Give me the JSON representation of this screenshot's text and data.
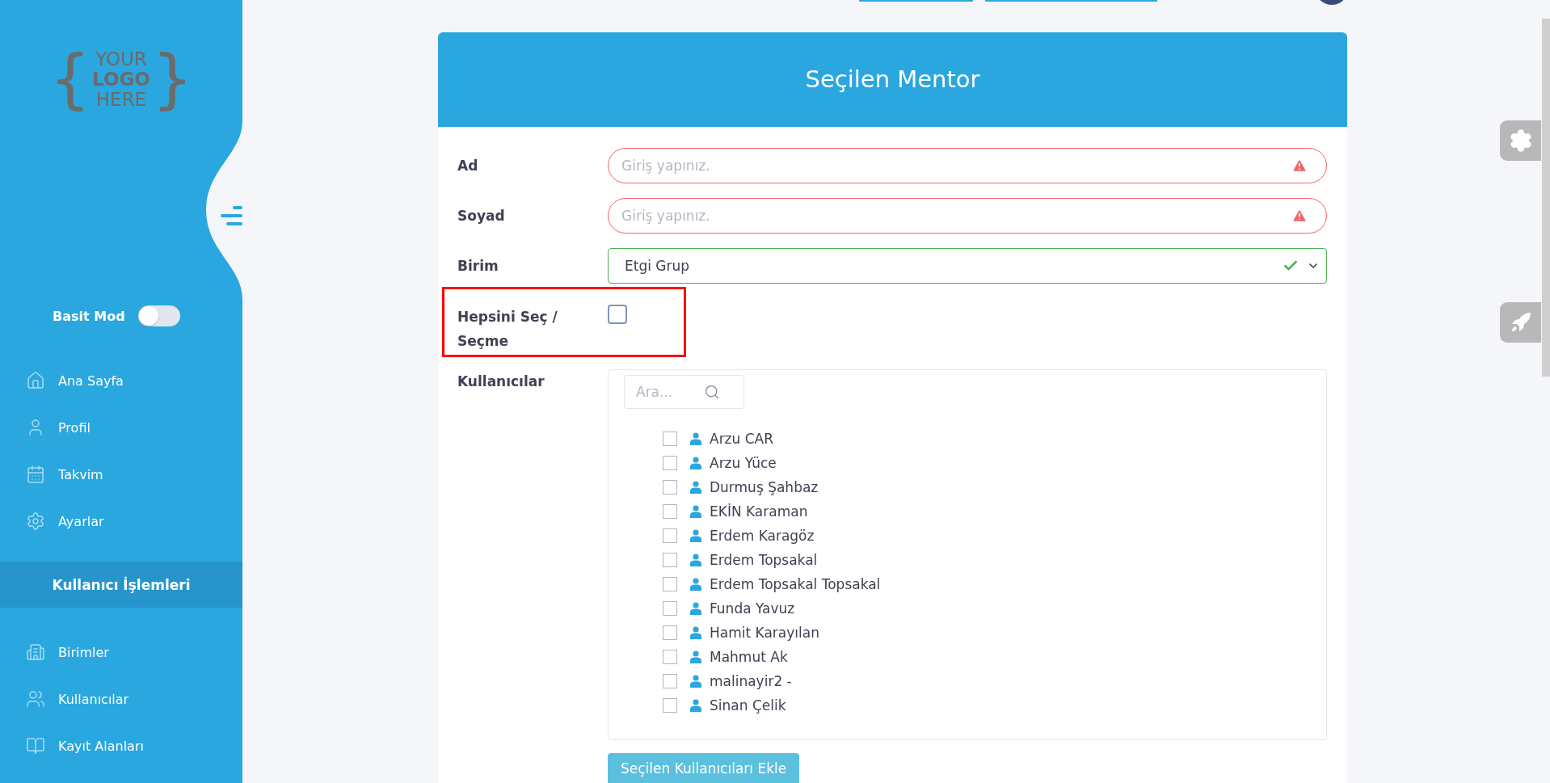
{
  "sidebar": {
    "logo": {
      "left_brace": "{",
      "top": "YOUR",
      "middle": "LOGO",
      "bottom": "HERE",
      "right_brace": "}"
    },
    "simple_mode": {
      "label": "Basit Mod",
      "on": false
    },
    "items": [
      {
        "label": "Ana Sayfa"
      },
      {
        "label": "Profil"
      },
      {
        "label": "Takvim"
      },
      {
        "label": "Ayarlar"
      }
    ],
    "section": {
      "label": "Kullanıcı İşlemleri",
      "selected": true
    },
    "section_items": [
      {
        "label": "Birimler"
      },
      {
        "label": "Kullanıcılar"
      },
      {
        "label": "Kayıt Alanları"
      }
    ]
  },
  "card": {
    "title": "Seçilen Mentor",
    "fields": [
      {
        "label": "Ad",
        "kind": "text",
        "placeholder": "Giriş yapınız.",
        "invalid": true
      },
      {
        "label": "Soyad",
        "kind": "text",
        "placeholder": "Giriş yapınız.",
        "invalid": true
      },
      {
        "label": "Birim",
        "kind": "select",
        "value": "Etgi Grup",
        "valid": true
      }
    ],
    "select_all": {
      "label": "Hepsini Seç / Seçme",
      "checked": false,
      "highlighted": true
    },
    "users": {
      "label": "Kullanıcılar",
      "search_placeholder": "Ara...",
      "items": [
        {
          "name": "Arzu CAR",
          "checked": false
        },
        {
          "name": "Arzu Yüce",
          "checked": false
        },
        {
          "name": "Durmuş Şahbaz",
          "checked": false
        },
        {
          "name": "EKİN Karaman",
          "checked": false
        },
        {
          "name": "Erdem Karagöz",
          "checked": false
        },
        {
          "name": "Erdem Topsakal",
          "checked": false
        },
        {
          "name": "Erdem Topsakal Topsakal",
          "checked": false
        },
        {
          "name": "Funda Yavuz",
          "checked": false
        },
        {
          "name": "Hamit Karayılan",
          "checked": false
        },
        {
          "name": "Mahmut Ak",
          "checked": false
        },
        {
          "name": "malinayir2 -",
          "checked": false
        },
        {
          "name": "Sinan Çelik",
          "checked": false
        }
      ]
    },
    "submit": "Seçilen Kullanıcıları Ekle"
  }
}
